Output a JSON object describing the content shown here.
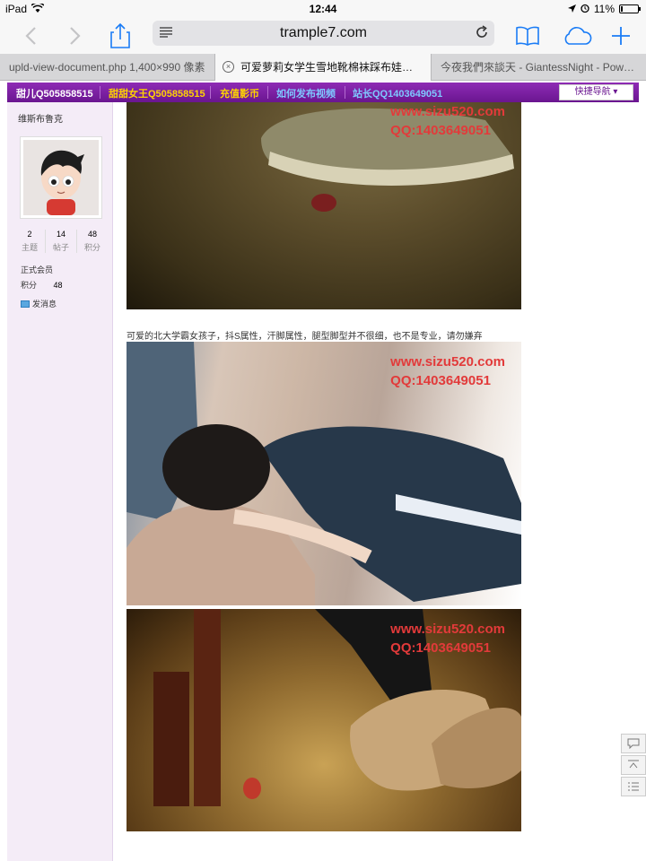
{
  "status_bar": {
    "device": "iPad",
    "time": "12:44",
    "battery": "11%"
  },
  "browser": {
    "url": "trample7.com",
    "tabs": [
      {
        "title": "upld-view-document.php 1,400×990 像素"
      },
      {
        "title": "可爱萝莉女学生雪地靴棉袜踩布娃娃~..."
      },
      {
        "title": "今夜我們來談天 - GiantessNight - Powe..."
      }
    ]
  },
  "site_nav": {
    "items": [
      {
        "label": "甜儿Q505858515",
        "color": "#ffffff"
      },
      {
        "label": "甜甜女王Q505858515",
        "color": "#ffd400"
      },
      {
        "label": "充值影币",
        "color": "#ffd400"
      },
      {
        "label": "如何发布视频",
        "color": "#7ec8ff"
      },
      {
        "label": "站长QQ1403649051",
        "color": "#7ec8ff"
      }
    ],
    "quick_nav": "快捷导航"
  },
  "profile": {
    "username": "维斯布鲁克",
    "stats": [
      {
        "value": "2",
        "label": "主题"
      },
      {
        "value": "14",
        "label": "帖子"
      },
      {
        "value": "48",
        "label": "积分"
      }
    ],
    "level": "正式会员",
    "points_label": "积分",
    "points_value": "48",
    "send_message": "发消息"
  },
  "post": {
    "caption": "可爱的北大学霸女孩子，抖S属性，汗脚属性，腿型脚型并不很细，也不是专业，请勿嫌弃",
    "images": [
      {
        "watermark_site": "www.sizu520.com",
        "watermark_qq": "QQ:1403649051"
      },
      {
        "watermark_site": "www.sizu520.com",
        "watermark_qq": "QQ:1403649051"
      },
      {
        "watermark_site": "www.sizu520.com",
        "watermark_qq": "QQ:1403649051"
      }
    ]
  }
}
